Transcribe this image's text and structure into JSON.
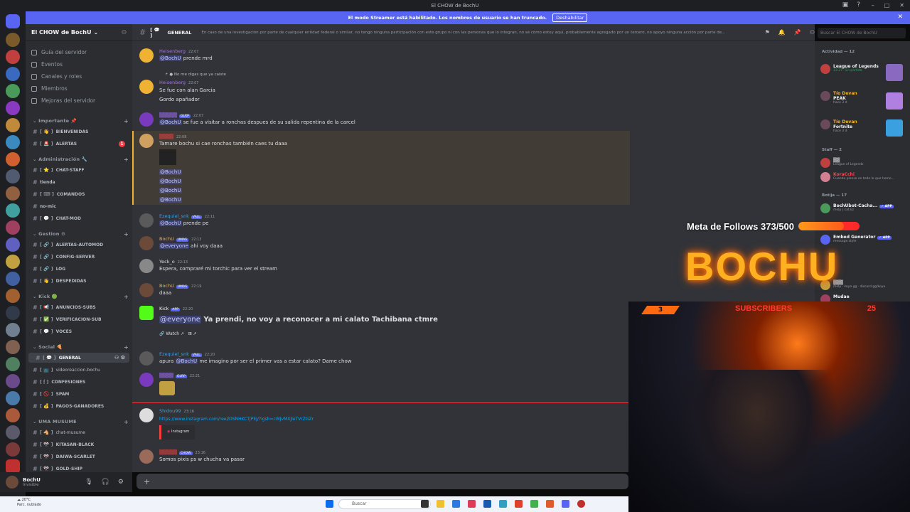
{
  "window": {
    "title": "El CHOW de BochU"
  },
  "banner": {
    "text": "El modo Streamer está habilitado. Los nombres de usuario se han truncado.",
    "button": "Deshabilitar"
  },
  "server": {
    "name": "El CHOW de BochU"
  },
  "nav": [
    "Guía del servidor",
    "Eventos",
    "Canales y roles",
    "Miembros",
    "Mejoras del servidor"
  ],
  "categories": {
    "importante": "Importante",
    "administracion": "Administración",
    "gestion": "Gestion",
    "kick": "Kick",
    "social": "Social",
    "musume": "UMA MUSUME"
  },
  "channels": {
    "bienvenidas": "BIENVENIDAS",
    "alertas": "ALERTAS",
    "alertas_badge": "1",
    "chat_staff": "CHAT-STAFF",
    "tienda": "tienda",
    "comandos": "COMANDOS",
    "no_mic": "no-mic",
    "chat_mod": "CHAT-MOD",
    "alertas_auto": "ALERTAS-AUTOMOD",
    "config_server": "CONFIG-SERVER",
    "log": "LOG",
    "despedidas": "DESPEDIDAS",
    "anuncios_subs": "ANUNCIOS-SUBS",
    "verificacion_sub": "VERIFICACION-SUB",
    "voces": "VOCES",
    "general": "GENERAL",
    "videoreaccion": "videoreaccion-bochu",
    "confesiones": "CONFESIONES",
    "spam": "SPAM",
    "pagos": "PAGOS-GANADORES",
    "chat_musume": "chat-musume",
    "kitasan": "KITASAN-BLACK",
    "daiwa": "DAIWA-SCARLET",
    "gold_ship": "GOLD-SHIP"
  },
  "user": {
    "name": "BochU",
    "status": "Invisible"
  },
  "header": {
    "channel": "GENERAL",
    "topic": "En caso de una investigación por parte de cualquier entidad federal o similar, no tengo ninguna participación con este grupo ni con las personas que lo integran, no sé cómo estoy aquí, probablemente agregado por un tercero, no apoyo ninguna acción por parte de...",
    "search_placeholder": "Buscar El CHOW de BochU"
  },
  "messages": [
    {
      "author": "Heisenberg",
      "time": "22:07",
      "text": "prende mrd",
      "mention": "@BochU"
    },
    {
      "reply": "No me digas que ya caiste",
      "author": "Heisenberg",
      "time": "22:07",
      "text": "Se fue con alan Garcia",
      "text2": "Gordo apañador"
    },
    {
      "tag": "GLRP",
      "time": "22:07",
      "text": "se fue a visitar a ronchas despues de su salida repentina de la carcel",
      "mention": "@BochU"
    },
    {
      "time": "22:08",
      "text": "Tamare bochu si cae ronchas también caes tu daaa",
      "mentions": [
        "@BochU",
        "@BochU",
        "@BochU",
        "@BochU"
      ]
    },
    {
      "author": "Ezequiel_snk",
      "tag": "VALL",
      "time": "22:11",
      "text": "prende pe",
      "mention": "@BochU"
    },
    {
      "author": "BochU",
      "tag": "UMAS",
      "time": "22:13",
      "text": "ahi voy daaa",
      "mention": "@everyone"
    },
    {
      "author": "Yeck_o",
      "time": "22:13",
      "text": "Espera, compraré mi torchic para ver el stream"
    },
    {
      "author": "BochU",
      "tag": "UMAS",
      "time": "22:19",
      "text": "daaa"
    },
    {
      "author": "Kick",
      "tag": "APP",
      "time": "22:20",
      "text": "Ya prendi, no voy a reconocer a mi calato Tachibana ctmre",
      "mention": "@everyone",
      "button": "Watch"
    },
    {
      "author": "Ezequiel_snk",
      "tag": "VALL",
      "time": "22:20",
      "text": "me imagino por ser el primer vas a estar calato? Dame chow",
      "pre": "apura",
      "mention": "@BochU"
    },
    {
      "tag": "GLRP",
      "time": "22:21"
    },
    {
      "author": "Shidou99",
      "time": "23:16",
      "text": "https://www.instagram.com/reel/DSNHKCTjPEJ/?igsh=cWJvMXJleTVrZGZr",
      "embed": "Instagram"
    },
    {
      "tag": "CHOW",
      "time": "23:16",
      "text": "Somos pixis ps w chucha va pasar"
    }
  ],
  "members": {
    "activity_header": "Actividad — 12",
    "a1_game": "League of Legends",
    "a1_sub": "13:27 · En partida",
    "a2_name": "Tío Devan",
    "a2_game": "PEAK",
    "a2_sub": "hace 3 d",
    "a3_name": "Tío Devan",
    "a3_game": "Fortnite",
    "a3_sub": "hace 3 d",
    "staff_header": "Staff — 2",
    "s1_sub": "League of Legends",
    "s2_name": "KoraCchi",
    "s2_sub": "Cuando pienso en todo lo que hemo...",
    "bots_header": "Botija — 17",
    "b1_name": "BochUbot-Cacha...",
    "b1_sub": "/help | cat.kz",
    "b2_name": "Embed Generator",
    "b2_sub": "message.style",
    "b3_sub": "/help · koya.gg · discord.gg/koya",
    "b4_name": "Mudae"
  },
  "stream": {
    "goal_label": "Meta de Follows 373/500",
    "goal_progress": 0.746,
    "logo": "BOCHU",
    "subs_label": "SUBSCRIBERS",
    "subs_left": "3",
    "subs_right": "25"
  },
  "taskbar": {
    "weather_temp": "20°C",
    "weather_desc": "Parc. nublado",
    "search": "Buscar"
  },
  "colors": {
    "accent": "#5865f2",
    "mention": "#c9cdfb",
    "stream_orange": "#ffb020",
    "goal_red": "#ff2a2a"
  }
}
